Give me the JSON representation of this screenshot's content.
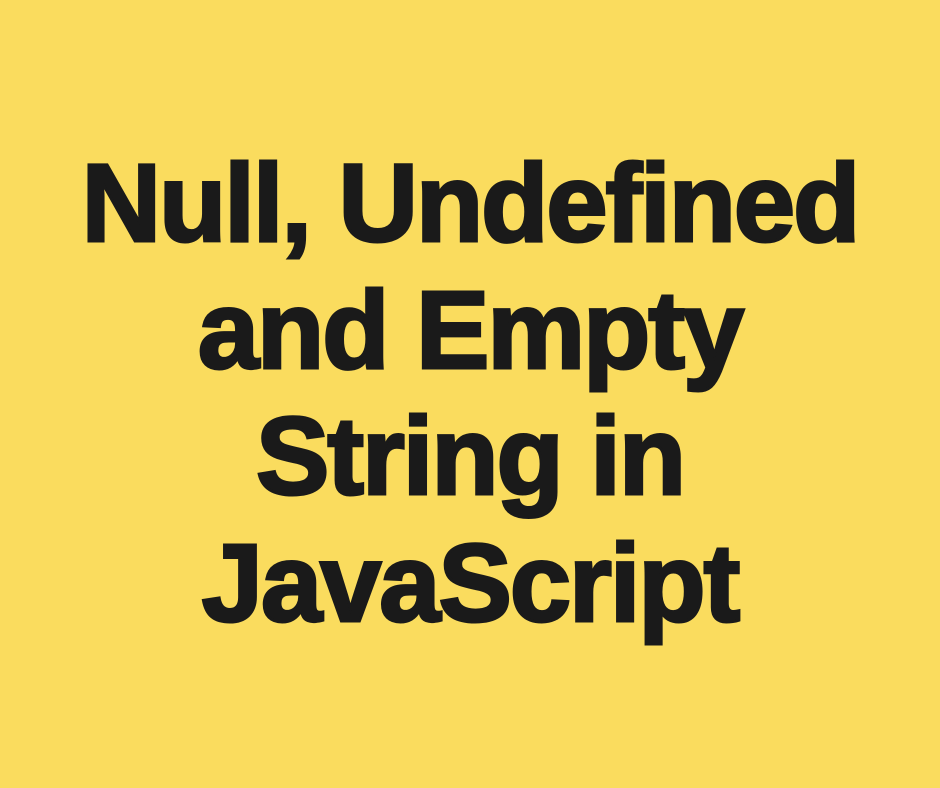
{
  "title": "Null, Undefined and Empty String in JavaScript",
  "background_color": "#fadc5e",
  "text_color": "#1a1a1a"
}
